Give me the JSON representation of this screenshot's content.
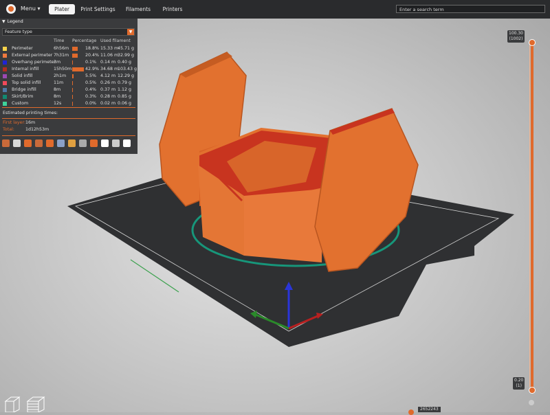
{
  "topbar": {
    "menu_label": "Menu ▾",
    "tabs": [
      {
        "label": "Plater",
        "active": true
      },
      {
        "label": "Print Settings",
        "active": false
      },
      {
        "label": "Filaments",
        "active": false
      },
      {
        "label": "Printers",
        "active": false
      }
    ],
    "search_placeholder": "Enter a search term"
  },
  "legend": {
    "title": "Legend",
    "view_type": "Feature type",
    "columns": [
      "Time",
      "Percentage",
      "Used filament"
    ],
    "rows": [
      {
        "name": "Perimeter",
        "time": "6h56m",
        "percentage": "18.8%",
        "length": "15.33 m",
        "weight": "45.71 g",
        "color": "#f7d24a",
        "share": 18.8
      },
      {
        "name": "External perimeter",
        "time": "7h31m",
        "percentage": "20.4%",
        "length": "11.06 m",
        "weight": "32.99 g",
        "color": "#ef7a3f",
        "share": 20.4
      },
      {
        "name": "Overhang perimeter",
        "time": "3m",
        "percentage": "0.1%",
        "length": "0.14 m",
        "weight": "0.40 g",
        "color": "#1f23d6",
        "share": 0.1
      },
      {
        "name": "Internal infill",
        "time": "15h50m",
        "percentage": "42.9%",
        "length": "34.68 m",
        "weight": "103.43 g",
        "color": "#b22d1f",
        "share": 42.9
      },
      {
        "name": "Solid infill",
        "time": "2h1m",
        "percentage": "5.5%",
        "length": "4.12 m",
        "weight": "12.29 g",
        "color": "#9b49b2",
        "share": 5.5
      },
      {
        "name": "Top solid infill",
        "time": "11m",
        "percentage": "0.5%",
        "length": "0.26 m",
        "weight": "0.79 g",
        "color": "#f1495a",
        "share": 0.5
      },
      {
        "name": "Bridge infill",
        "time": "8m",
        "percentage": "0.4%",
        "length": "0.37 m",
        "weight": "1.12 g",
        "color": "#4f79a8",
        "share": 0.4
      },
      {
        "name": "Skirt/Brim",
        "time": "8m",
        "percentage": "0.3%",
        "length": "0.28 m",
        "weight": "0.85 g",
        "color": "#128a72",
        "share": 0.3
      },
      {
        "name": "Custom",
        "time": "12s",
        "percentage": "0.0%",
        "length": "0.02 m",
        "weight": "0.06 g",
        "color": "#3fd39a",
        "share": 0.0
      }
    ],
    "estimated_label": "Estimated printing times:",
    "first_layer_label": "First layer:",
    "first_layer_value": "16m",
    "total_label": "Total:",
    "total_value": "1d12h53m",
    "tool_icons": [
      "travel-icon",
      "wipe-icon",
      "retraction-icon",
      "deretraction-icon",
      "seam-icon",
      "tool-change-icon",
      "color-change-icon",
      "pause-icon",
      "custom-gcode-icon",
      "center-of-gravity-icon",
      "shells-icon",
      "tool-marker-icon"
    ]
  },
  "layer_slider": {
    "top_value": "100.30",
    "top_layer": "(1002)",
    "bottom_value": "0.20",
    "bottom_layer": "(1)",
    "level": 1.0
  },
  "move_slider": {
    "value": "2652243"
  },
  "accent_color": "#e06a2c"
}
